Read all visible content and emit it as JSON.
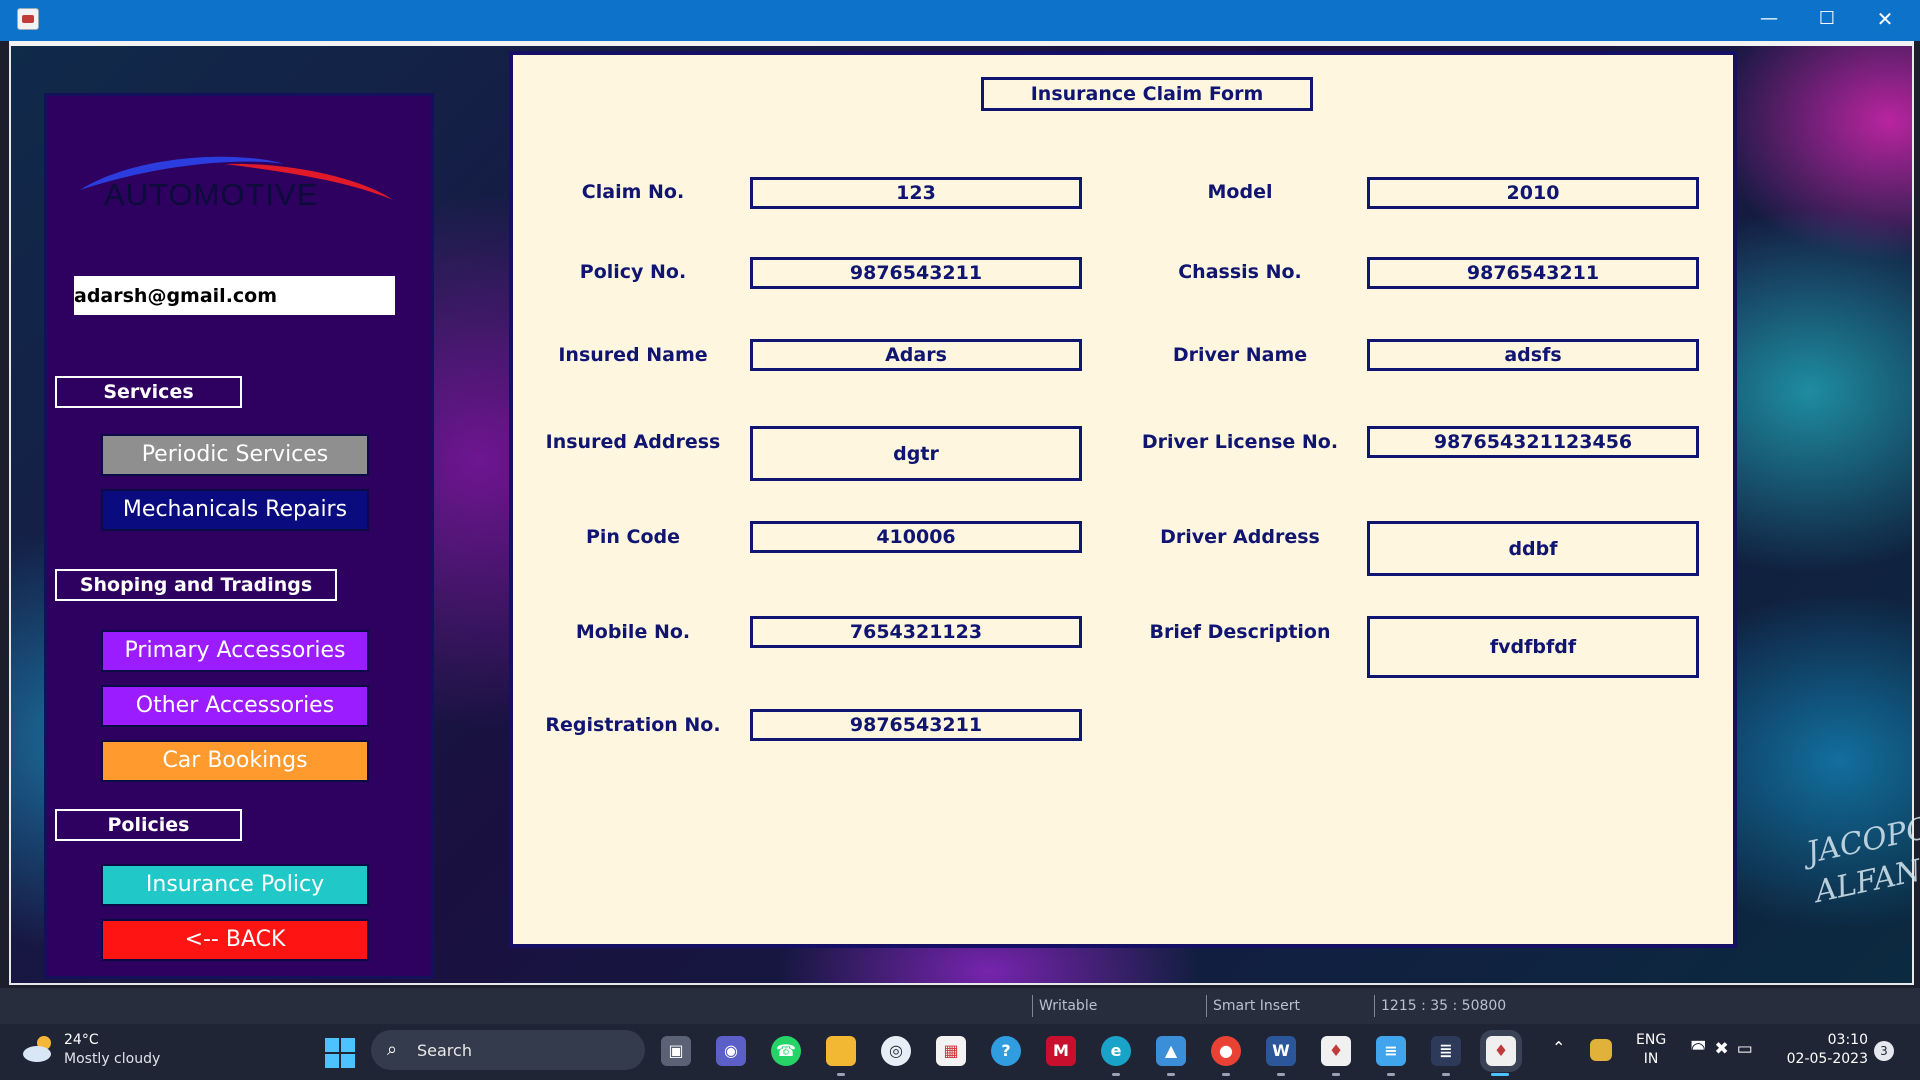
{
  "window": {
    "minimize_glyph": "—",
    "maximize_glyph": "☐",
    "close_glyph": "✕"
  },
  "sidebar": {
    "logo_text": "AUTOMOTIVE",
    "email_value": "adarsh@gmail.com",
    "services_label": "Services",
    "periodic_services": "Periodic Services",
    "mechanical_repairs": "Mechanicals Repairs",
    "shopping_label": "Shoping and Tradings",
    "primary_accessories": "Primary Accessories",
    "other_accessories": "Other Accessories",
    "car_bookings": "Car Bookings",
    "policies_label": "Policies",
    "insurance_policy": "Insurance Policy",
    "back": "<-- BACK",
    "colors": {
      "panel": "#2e005f",
      "periodic": "#8f8f8f",
      "mechanical": "#0b0b80",
      "primary": "#9b1cff",
      "other": "#9b1cff",
      "bookings": "#ff9a2e",
      "insurance": "#21c8c8",
      "back": "#ff1414"
    }
  },
  "form": {
    "title": "Insurance Claim Form",
    "left": {
      "claim_no": {
        "label": "Claim No.",
        "value": "123"
      },
      "policy_no": {
        "label": "Policy No.",
        "value": "9876543211"
      },
      "insured_name": {
        "label": "Insured Name",
        "value": "Adars"
      },
      "insured_address": {
        "label": "Insured Address",
        "value": "dgtr"
      },
      "pin_code": {
        "label": "Pin Code",
        "value": "410006"
      },
      "mobile_no": {
        "label": "Mobile No.",
        "value": "7654321123"
      },
      "registration_no": {
        "label": "Registration No.",
        "value": "9876543211"
      }
    },
    "right": {
      "model": {
        "label": "Model",
        "value": "2010"
      },
      "chassis_no": {
        "label": "Chassis No.",
        "value": "9876543211"
      },
      "driver_name": {
        "label": "Driver Name",
        "value": "adsfs"
      },
      "driver_license": {
        "label": "Driver License No.",
        "value": "987654321123456"
      },
      "driver_address": {
        "label": "Driver Address",
        "value": "ddbf"
      },
      "brief_description": {
        "label": "Brief Description",
        "value": "fvdfbfdf"
      }
    }
  },
  "watermark": "JACOPO ALFANO",
  "statusbar": {
    "mode": "Writable",
    "insert": "Smart Insert",
    "position": "1215 : 35 : 50800"
  },
  "taskbar": {
    "weather_temp": "24°C",
    "weather_desc": "Mostly cloudy",
    "search_label": "Search",
    "lang_line1": "ENG",
    "lang_line2": "IN",
    "time": "03:10",
    "date": "02-05-2023",
    "notifications": "3",
    "icons": [
      "task-view",
      "teams",
      "whatsapp",
      "file-explorer",
      "app-circle",
      "microsoft-store",
      "help",
      "mcafee",
      "edge",
      "photos",
      "chrome",
      "word",
      "java-app",
      "notepad",
      "terminal",
      "java-app-active"
    ]
  }
}
